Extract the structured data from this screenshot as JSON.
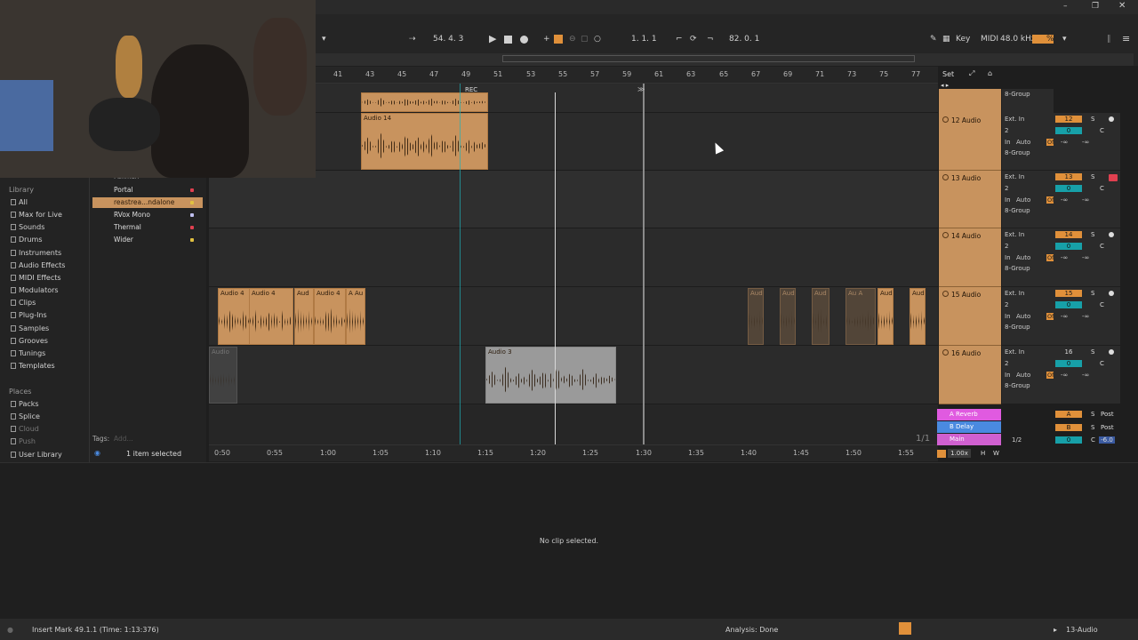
{
  "transport": {
    "position": "54.  4.  3",
    "loop_start": "1.   1.   1",
    "tempo_bars": "82.   0.   1",
    "key_label": "Key",
    "midi_label": "MIDI",
    "sample_rate": "48.0 kHz",
    "cpu": "%"
  },
  "ruler": {
    "bars": [
      "41",
      "43",
      "45",
      "47",
      "49",
      "51",
      "53",
      "55",
      "57",
      "59",
      "61",
      "63",
      "65",
      "67",
      "69",
      "71",
      "73",
      "75",
      "77"
    ],
    "set_label": "Set",
    "rec_label": "REC"
  },
  "time_ruler": {
    "times": [
      "0:50",
      "0:55",
      "1:00",
      "1:05",
      "1:10",
      "1:15",
      "1:20",
      "1:25",
      "1:30",
      "1:35",
      "1:40",
      "1:45",
      "1:50",
      "1:55"
    ]
  },
  "clips": {
    "audio14": "Audio 14",
    "audio4": "Audio 4",
    "audio4b": "Audio 4",
    "aud1": "Aud",
    "audio4c": "Audio 4",
    "a4": "A Au",
    "audio3": "Audio 3",
    "audio_ghost": "Audio",
    "aud_ghost1": "Aud",
    "aud_ghost2": "Aud",
    "aud_ghost3": "Aud",
    "au_ghost4": "Au A",
    "aud5": "Aud",
    "aud6": "Aud"
  },
  "tracks": [
    {
      "name": "12 Audio",
      "input": "Ext. In",
      "channel": "2",
      "group": "8-Group",
      "number": "12",
      "vol": "0",
      "pan": "C",
      "armed": false
    },
    {
      "name": "13 Audio",
      "input": "Ext. In",
      "channel": "2",
      "group": "8-Group",
      "number": "13",
      "vol": "0",
      "pan": "C",
      "armed": true
    },
    {
      "name": "14 Audio",
      "input": "Ext. In",
      "channel": "2",
      "group": "8-Group",
      "number": "14",
      "vol": "0",
      "pan": "C",
      "armed": false
    },
    {
      "name": "15 Audio",
      "input": "Ext. In",
      "channel": "2",
      "group": "8-Group",
      "number": "15",
      "vol": "0",
      "pan": "C",
      "armed": false
    },
    {
      "name": "16 Audio",
      "input": "Ext. In",
      "channel": "2",
      "group": "8-Group",
      "number": "16",
      "vol": "0",
      "pan": "C",
      "armed": false
    }
  ],
  "monitor": {
    "in": "In",
    "auto": "Auto",
    "off": "Off",
    "inf": "-∞",
    "s": "S"
  },
  "top_group": "8-Group",
  "returns": [
    {
      "name": "A Reverb",
      "letter": "A",
      "mode": "Post",
      "color": "#e05ae0"
    },
    {
      "name": "B Delay",
      "letter": "B",
      "mode": "Post",
      "color": "#4a8ae0"
    },
    {
      "name": "Main",
      "letter": "0",
      "mode": "-6.0",
      "color": "#d060d0",
      "input": "1/2"
    }
  ],
  "page_fraction": "1/1",
  "zoom": "1.00x",
  "h_label": "H",
  "w_label": "W",
  "library": {
    "heading": "Library",
    "items": [
      "All",
      "Max for Live",
      "Sounds",
      "Drums",
      "Instruments",
      "Audio Effects",
      "MIDI Effects",
      "Modulators",
      "Clips",
      "Plug-Ins",
      "Samples",
      "Grooves",
      "Tunings",
      "Templates"
    ],
    "places_heading": "Places",
    "places": [
      "Packs",
      "Splice",
      "Cloud",
      "Push",
      "User Library"
    ]
  },
  "browser_items": [
    {
      "name": "Portal",
      "color": "#e04050"
    },
    {
      "name": "reastrea...ndalone",
      "color": "#e0c040",
      "selected": true
    },
    {
      "name": "RVox Mono",
      "color": "#c0c0f0"
    },
    {
      "name": "Thermal",
      "color": "#e04050"
    },
    {
      "name": "Wider",
      "color": "#e0c040"
    }
  ],
  "browser_partial": "Pahman",
  "tags_label": "Tags:",
  "tags_placeholder": "Add...",
  "selection_count": "1 item selected",
  "detail_message": "No clip selected.",
  "status": {
    "left": "Insert Mark 49.1.1 (Time: 1:13:376)",
    "center": "Analysis: Done",
    "right": "13-Audio"
  }
}
